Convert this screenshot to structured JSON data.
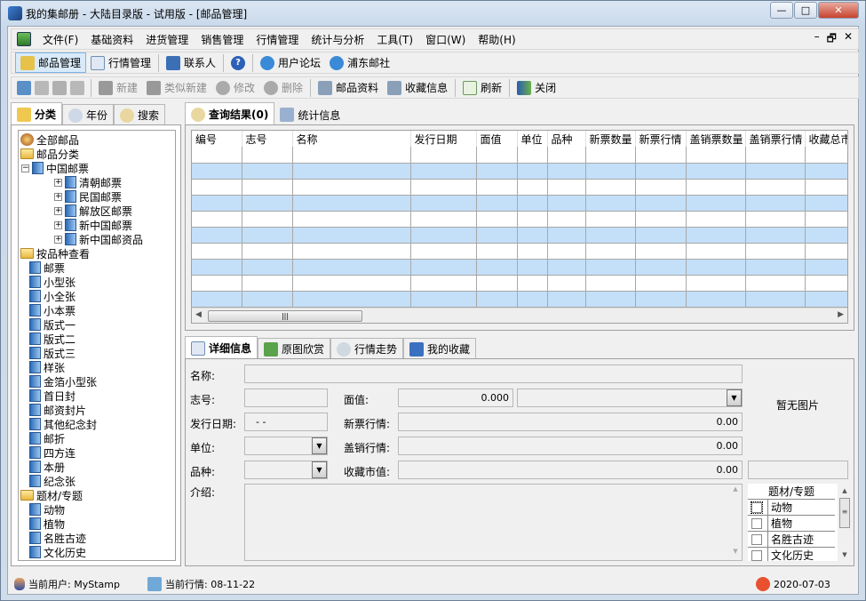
{
  "window": {
    "title": "我的集邮册 - 大陆目录版 - 试用版 - [邮品管理]",
    "minimize": "—",
    "maximize": "□",
    "close": "✕"
  },
  "menu": [
    "文件(F)",
    "基础资料",
    "进货管理",
    "销售管理",
    "行情管理",
    "统计与分析",
    "工具(T)",
    "窗口(W)",
    "帮助(H)"
  ],
  "mdi_controls": [
    "–",
    "🗗",
    "✕"
  ],
  "toolbar1": [
    {
      "label": "邮品管理",
      "icon": "stamp-icon",
      "active": true
    },
    {
      "label": "行情管理",
      "icon": "document-icon"
    },
    {
      "label": "联系人",
      "icon": "contact-card-icon"
    },
    {
      "label": "",
      "icon": "help-icon"
    },
    {
      "label": "用户论坛",
      "icon": "ie-icon"
    },
    {
      "label": "浦东邮社",
      "icon": "ie-icon"
    }
  ],
  "toolbar2": [
    {
      "label": "新建",
      "enabled": false
    },
    {
      "label": "类似新建",
      "enabled": false
    },
    {
      "label": "修改",
      "enabled": false
    },
    {
      "label": "删除",
      "enabled": false
    },
    {
      "label": "邮品资料",
      "enabled": true
    },
    {
      "label": "收藏信息",
      "enabled": true
    },
    {
      "label": "刷新",
      "enabled": true
    },
    {
      "label": "关闭",
      "enabled": true
    }
  ],
  "left_tabs": [
    "分类",
    "年份",
    "搜索"
  ],
  "tree": [
    {
      "label": "全部邮品",
      "level": 0,
      "icon": "root"
    },
    {
      "label": "邮品分类",
      "level": 0,
      "icon": "folder"
    },
    {
      "label": "中国邮票",
      "level": 1,
      "icon": "book",
      "expander": "⊟"
    },
    {
      "label": "清朝邮票",
      "level": 2,
      "icon": "book",
      "expander": "⊞"
    },
    {
      "label": "民国邮票",
      "level": 2,
      "icon": "book",
      "expander": "⊞"
    },
    {
      "label": "解放区邮票",
      "level": 2,
      "icon": "book",
      "expander": "⊞"
    },
    {
      "label": "新中国邮票",
      "level": 2,
      "icon": "book",
      "expander": "⊞"
    },
    {
      "label": "新中国邮资品",
      "level": 2,
      "icon": "book",
      "expander": "⊞"
    },
    {
      "label": "按品种查看",
      "level": 0,
      "icon": "folder"
    },
    {
      "label": "邮票",
      "level": 1,
      "icon": "book"
    },
    {
      "label": "小型张",
      "level": 1,
      "icon": "book"
    },
    {
      "label": "小全张",
      "level": 1,
      "icon": "book"
    },
    {
      "label": "小本票",
      "level": 1,
      "icon": "book"
    },
    {
      "label": "版式一",
      "level": 1,
      "icon": "book"
    },
    {
      "label": "版式二",
      "level": 1,
      "icon": "book"
    },
    {
      "label": "版式三",
      "level": 1,
      "icon": "book"
    },
    {
      "label": "样张",
      "level": 1,
      "icon": "book"
    },
    {
      "label": "金箔小型张",
      "level": 1,
      "icon": "book"
    },
    {
      "label": "首日封",
      "level": 1,
      "icon": "book"
    },
    {
      "label": "邮资封片",
      "level": 1,
      "icon": "book"
    },
    {
      "label": "其他纪念封",
      "level": 1,
      "icon": "book"
    },
    {
      "label": "邮折",
      "level": 1,
      "icon": "book"
    },
    {
      "label": "四方连",
      "level": 1,
      "icon": "book"
    },
    {
      "label": "本册",
      "level": 1,
      "icon": "book"
    },
    {
      "label": "纪念张",
      "level": 1,
      "icon": "book"
    },
    {
      "label": "题材/专题",
      "level": 0,
      "icon": "folder"
    },
    {
      "label": "动物",
      "level": 1,
      "icon": "book"
    },
    {
      "label": "植物",
      "level": 1,
      "icon": "book"
    },
    {
      "label": "名胜古迹",
      "level": 1,
      "icon": "book"
    },
    {
      "label": "文化历史",
      "level": 1,
      "icon": "book"
    }
  ],
  "result_tabs": [
    "查询结果(0)",
    "统计信息"
  ],
  "grid": {
    "columns": [
      "编号",
      "志号",
      "名称",
      "发行日期",
      "面值",
      "单位",
      "品种",
      "新票数量",
      "新票行情",
      "盖销票数量",
      "盖销票行情",
      "收藏总市"
    ],
    "row_count": 10
  },
  "detail_tabs": [
    "详细信息",
    "原图欣赏",
    "行情走势",
    "我的收藏"
  ],
  "detail": {
    "name_label": "名称:",
    "name_value": "",
    "zhihao_label": "志号:",
    "zhihao_value": "",
    "mianzhi_label": "面值:",
    "mianzhi_value": "0.000",
    "date_label": "发行日期:",
    "date_value": " - - ",
    "xinpiao_label": "新票行情:",
    "xinpiao_value": "0.00",
    "unit_label": "单位:",
    "unit_value": "",
    "gaixiao_label": "盖销行情:",
    "gaixiao_value": "0.00",
    "kind_label": "品种:",
    "kind_value": "",
    "shizhi_label": "收藏市值:",
    "shizhi_value": "0.00",
    "intro_label": "介绍:",
    "intro_value": "",
    "no_image": "暂无图片",
    "topic_header": "题材/专题",
    "topics": [
      "动物",
      "植物",
      "名胜古迹",
      "文化历史"
    ]
  },
  "status": {
    "user": "当前用户: MyStamp",
    "market": "当前行情: 08-11-22",
    "date": "2020-07-03"
  }
}
